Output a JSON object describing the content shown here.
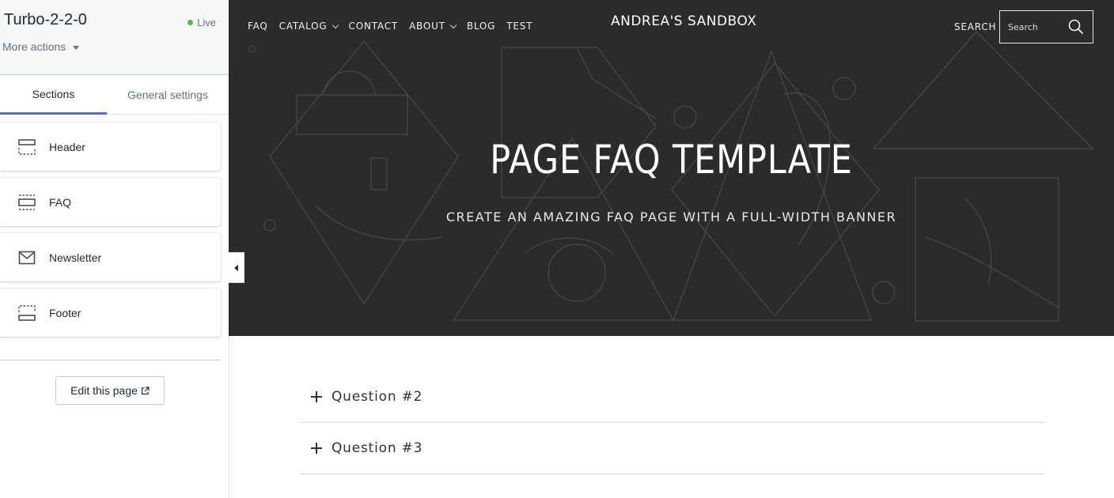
{
  "editor": {
    "theme_name": "Turbo-2-2-0",
    "status": "Live",
    "more_actions": "More actions",
    "tabs": [
      {
        "label": "Sections",
        "active": true
      },
      {
        "label": "General settings",
        "active": false
      }
    ],
    "sections": [
      {
        "label": "Header",
        "icon": "header-layout-icon"
      },
      {
        "label": "FAQ",
        "icon": "section-layout-icon"
      },
      {
        "label": "Newsletter",
        "icon": "envelope-icon"
      },
      {
        "label": "Footer",
        "icon": "footer-layout-icon"
      }
    ],
    "edit_page": "Edit this page",
    "accent_color": "#5c6ac4",
    "live_color": "#50b83c"
  },
  "store": {
    "nav": [
      {
        "label": "FAQ",
        "has_dropdown": false
      },
      {
        "label": "CATALOG",
        "has_dropdown": true
      },
      {
        "label": "CONTACT",
        "has_dropdown": false
      },
      {
        "label": "ABOUT",
        "has_dropdown": true
      },
      {
        "label": "BLOG",
        "has_dropdown": false
      },
      {
        "label": "TEST",
        "has_dropdown": false
      }
    ],
    "site_title": "ANDREA'S SANDBOX",
    "search_label": "SEARCH",
    "search_placeholder": "Search",
    "banner": {
      "title": "PAGE FAQ TEMPLATE",
      "subtitle": "CREATE AN AMAZING FAQ PAGE WITH A FULL-WIDTH BANNER",
      "background_color": "#2b2b2d"
    },
    "faq": [
      {
        "question": "Question #2"
      },
      {
        "question": "Question #3"
      }
    ]
  }
}
